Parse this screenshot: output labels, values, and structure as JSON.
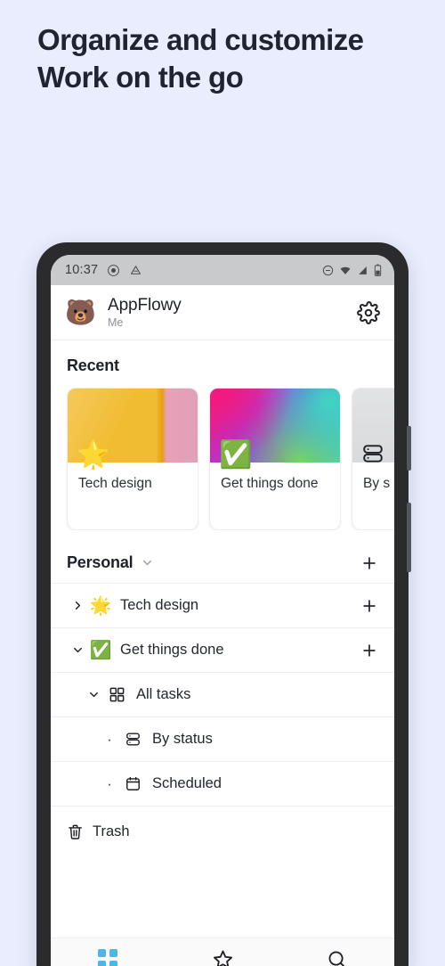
{
  "headline": {
    "line1": "Organize and customize",
    "line2": "Work on the go"
  },
  "colors": {
    "background": "#e9edfd",
    "headline_text": "#1f2430",
    "phone_bezel": "#2b2b2d",
    "statusbar_bg": "#c9cacb",
    "accent_nav_active": "#4db6e8"
  },
  "statusbar": {
    "time": "10:37",
    "left_icons": [
      "screen-record-icon",
      "drive-icon"
    ],
    "right_icons": [
      "do-not-disturb-icon",
      "wifi-icon",
      "signal-icon",
      "battery-icon"
    ]
  },
  "appbar": {
    "avatar_emoji": "🐻",
    "title": "AppFlowy",
    "subtitle": "Me",
    "settings_icon": "gear-icon"
  },
  "recent": {
    "title": "Recent",
    "cards": [
      {
        "label": "Tech design",
        "emoji": "🌟",
        "cover": "tech",
        "icon": ""
      },
      {
        "label": "Get things done",
        "emoji": "✅",
        "cover": "rainbow",
        "icon": ""
      },
      {
        "label": "By s",
        "emoji": "",
        "cover": "gray",
        "icon": "board-icon"
      }
    ]
  },
  "personal": {
    "title": "Personal",
    "collapse_icon": "chevron-down-icon",
    "add_icon": "plus-icon",
    "items": [
      {
        "label": "Tech design",
        "emoji": "🌟",
        "twisty": "chevron-right-icon",
        "indent": 0,
        "add_icon": "plus-icon",
        "icon": ""
      },
      {
        "label": "Get things done",
        "emoji": "✅",
        "twisty": "chevron-down-icon",
        "indent": 0,
        "add_icon": "plus-icon",
        "icon": ""
      },
      {
        "label": "All tasks",
        "emoji": "",
        "twisty": "chevron-down-icon",
        "indent": 1,
        "add_icon": "",
        "icon": "grid-icon"
      },
      {
        "label": "By status",
        "emoji": "",
        "twisty": "bullet",
        "indent": 2,
        "add_icon": "",
        "icon": "board-icon"
      },
      {
        "label": "Scheduled",
        "emoji": "",
        "twisty": "bullet",
        "indent": 2,
        "add_icon": "",
        "icon": "calendar-icon"
      }
    ]
  },
  "trash": {
    "label": "Trash",
    "icon": "trash-icon"
  },
  "bottomnav": {
    "items": [
      {
        "icon": "grid-icon",
        "active": true
      },
      {
        "icon": "star-icon",
        "active": false
      },
      {
        "icon": "search-icon",
        "active": false
      }
    ]
  }
}
